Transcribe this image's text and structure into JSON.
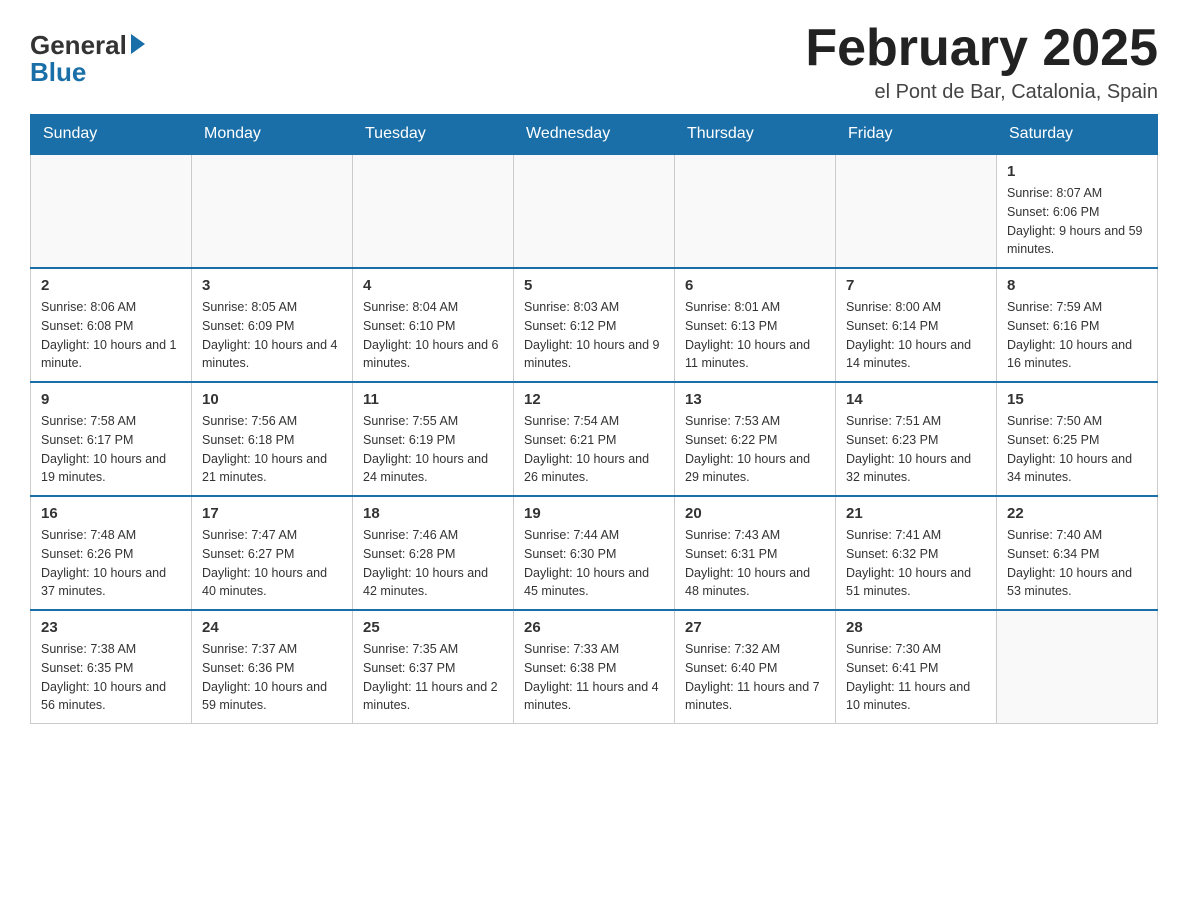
{
  "logo": {
    "general": "General",
    "blue": "Blue"
  },
  "header": {
    "month": "February 2025",
    "location": "el Pont de Bar, Catalonia, Spain"
  },
  "days_of_week": [
    "Sunday",
    "Monday",
    "Tuesday",
    "Wednesday",
    "Thursday",
    "Friday",
    "Saturday"
  ],
  "weeks": [
    [
      {
        "day": "",
        "info": ""
      },
      {
        "day": "",
        "info": ""
      },
      {
        "day": "",
        "info": ""
      },
      {
        "day": "",
        "info": ""
      },
      {
        "day": "",
        "info": ""
      },
      {
        "day": "",
        "info": ""
      },
      {
        "day": "1",
        "info": "Sunrise: 8:07 AM\nSunset: 6:06 PM\nDaylight: 9 hours and 59 minutes."
      }
    ],
    [
      {
        "day": "2",
        "info": "Sunrise: 8:06 AM\nSunset: 6:08 PM\nDaylight: 10 hours and 1 minute."
      },
      {
        "day": "3",
        "info": "Sunrise: 8:05 AM\nSunset: 6:09 PM\nDaylight: 10 hours and 4 minutes."
      },
      {
        "day": "4",
        "info": "Sunrise: 8:04 AM\nSunset: 6:10 PM\nDaylight: 10 hours and 6 minutes."
      },
      {
        "day": "5",
        "info": "Sunrise: 8:03 AM\nSunset: 6:12 PM\nDaylight: 10 hours and 9 minutes."
      },
      {
        "day": "6",
        "info": "Sunrise: 8:01 AM\nSunset: 6:13 PM\nDaylight: 10 hours and 11 minutes."
      },
      {
        "day": "7",
        "info": "Sunrise: 8:00 AM\nSunset: 6:14 PM\nDaylight: 10 hours and 14 minutes."
      },
      {
        "day": "8",
        "info": "Sunrise: 7:59 AM\nSunset: 6:16 PM\nDaylight: 10 hours and 16 minutes."
      }
    ],
    [
      {
        "day": "9",
        "info": "Sunrise: 7:58 AM\nSunset: 6:17 PM\nDaylight: 10 hours and 19 minutes."
      },
      {
        "day": "10",
        "info": "Sunrise: 7:56 AM\nSunset: 6:18 PM\nDaylight: 10 hours and 21 minutes."
      },
      {
        "day": "11",
        "info": "Sunrise: 7:55 AM\nSunset: 6:19 PM\nDaylight: 10 hours and 24 minutes."
      },
      {
        "day": "12",
        "info": "Sunrise: 7:54 AM\nSunset: 6:21 PM\nDaylight: 10 hours and 26 minutes."
      },
      {
        "day": "13",
        "info": "Sunrise: 7:53 AM\nSunset: 6:22 PM\nDaylight: 10 hours and 29 minutes."
      },
      {
        "day": "14",
        "info": "Sunrise: 7:51 AM\nSunset: 6:23 PM\nDaylight: 10 hours and 32 minutes."
      },
      {
        "day": "15",
        "info": "Sunrise: 7:50 AM\nSunset: 6:25 PM\nDaylight: 10 hours and 34 minutes."
      }
    ],
    [
      {
        "day": "16",
        "info": "Sunrise: 7:48 AM\nSunset: 6:26 PM\nDaylight: 10 hours and 37 minutes."
      },
      {
        "day": "17",
        "info": "Sunrise: 7:47 AM\nSunset: 6:27 PM\nDaylight: 10 hours and 40 minutes."
      },
      {
        "day": "18",
        "info": "Sunrise: 7:46 AM\nSunset: 6:28 PM\nDaylight: 10 hours and 42 minutes."
      },
      {
        "day": "19",
        "info": "Sunrise: 7:44 AM\nSunset: 6:30 PM\nDaylight: 10 hours and 45 minutes."
      },
      {
        "day": "20",
        "info": "Sunrise: 7:43 AM\nSunset: 6:31 PM\nDaylight: 10 hours and 48 minutes."
      },
      {
        "day": "21",
        "info": "Sunrise: 7:41 AM\nSunset: 6:32 PM\nDaylight: 10 hours and 51 minutes."
      },
      {
        "day": "22",
        "info": "Sunrise: 7:40 AM\nSunset: 6:34 PM\nDaylight: 10 hours and 53 minutes."
      }
    ],
    [
      {
        "day": "23",
        "info": "Sunrise: 7:38 AM\nSunset: 6:35 PM\nDaylight: 10 hours and 56 minutes."
      },
      {
        "day": "24",
        "info": "Sunrise: 7:37 AM\nSunset: 6:36 PM\nDaylight: 10 hours and 59 minutes."
      },
      {
        "day": "25",
        "info": "Sunrise: 7:35 AM\nSunset: 6:37 PM\nDaylight: 11 hours and 2 minutes."
      },
      {
        "day": "26",
        "info": "Sunrise: 7:33 AM\nSunset: 6:38 PM\nDaylight: 11 hours and 4 minutes."
      },
      {
        "day": "27",
        "info": "Sunrise: 7:32 AM\nSunset: 6:40 PM\nDaylight: 11 hours and 7 minutes."
      },
      {
        "day": "28",
        "info": "Sunrise: 7:30 AM\nSunset: 6:41 PM\nDaylight: 11 hours and 10 minutes."
      },
      {
        "day": "",
        "info": ""
      }
    ]
  ]
}
